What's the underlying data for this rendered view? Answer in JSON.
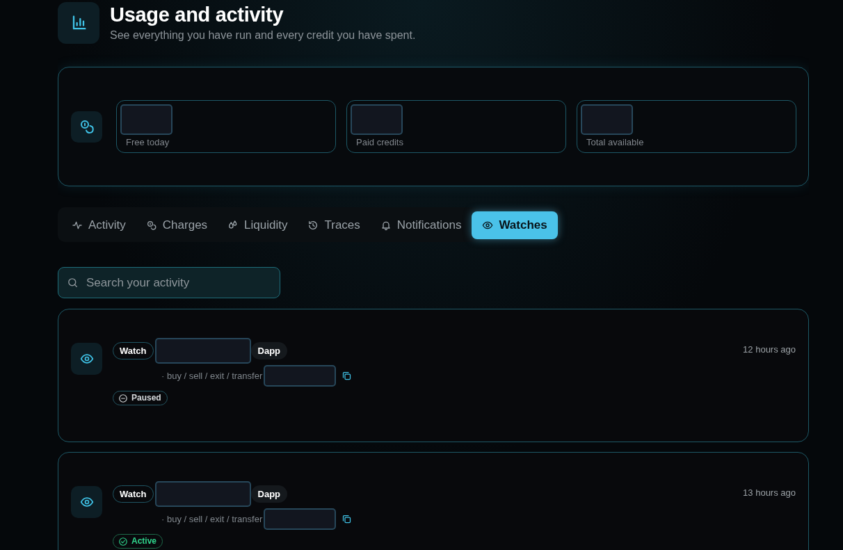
{
  "header": {
    "title": "Usage and activity",
    "subtitle": "See everything you have run and every credit you have spent."
  },
  "credits": [
    {
      "label": "Free today"
    },
    {
      "label": "Paid credits"
    },
    {
      "label": "Total available"
    }
  ],
  "tabs": [
    {
      "label": "Activity",
      "kind": "pulse",
      "selected": false
    },
    {
      "label": "Charges",
      "kind": "coins",
      "selected": false
    },
    {
      "label": "Liquidity",
      "kind": "drops",
      "selected": false
    },
    {
      "label": "Traces",
      "kind": "history",
      "selected": false
    },
    {
      "label": "Notifications",
      "kind": "bell",
      "selected": false
    },
    {
      "label": "Watches",
      "kind": "eye",
      "selected": true
    }
  ],
  "search": {
    "placeholder": "Search your activity"
  },
  "watches": [
    {
      "tag": "Watch",
      "chain": "Dapp",
      "actions": "· buy / sell / exit / transfer",
      "status": "Paused",
      "kind": "paused",
      "time": "12 hours ago"
    },
    {
      "tag": "Watch",
      "chain": "Dapp",
      "actions": "· buy / sell / exit / transfer",
      "status": "Active",
      "kind": "active",
      "time": "13 hours ago"
    }
  ]
}
